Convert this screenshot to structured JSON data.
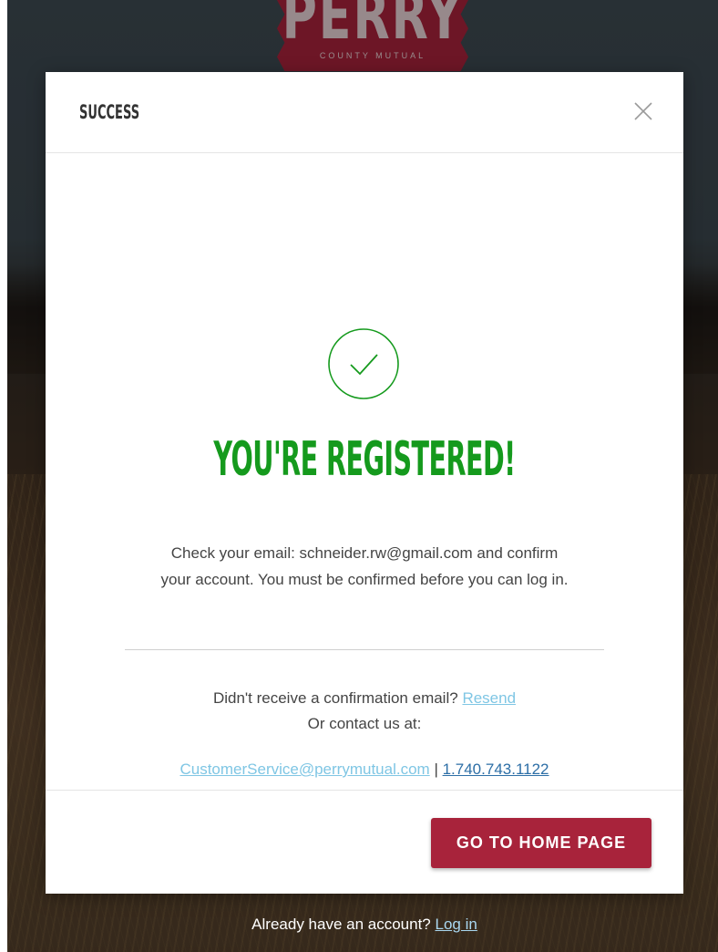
{
  "brand": {
    "logo_text": "PERRY",
    "logo_subtext": "COUNTY MUTUAL"
  },
  "modal": {
    "title": "SUCCESS",
    "headline": "YOU'RE REGISTERED!",
    "message": "Check your email: schneider.rw@gmail.com and confirm your account. You must be confirmed before you can log in.",
    "resend_prompt": "Didn't receive a confirmation email?",
    "resend_link": "Resend",
    "contact_prompt": "Or contact us at:",
    "contact_email": "CustomerService@perrymutual.com",
    "contact_separator": "|",
    "contact_phone": "1.740.743.1122",
    "home_button": "GO TO HOME PAGE"
  },
  "footer": {
    "account_prompt": "Already have an account?",
    "login_link": "Log in"
  },
  "colors": {
    "brand_red": "#a8233b",
    "success_green": "#159a1d",
    "link_light_blue": "#7fc6e4",
    "link_blue": "#2c6ea6"
  },
  "icons": {
    "close": "close-icon",
    "success": "check-circle-icon"
  }
}
